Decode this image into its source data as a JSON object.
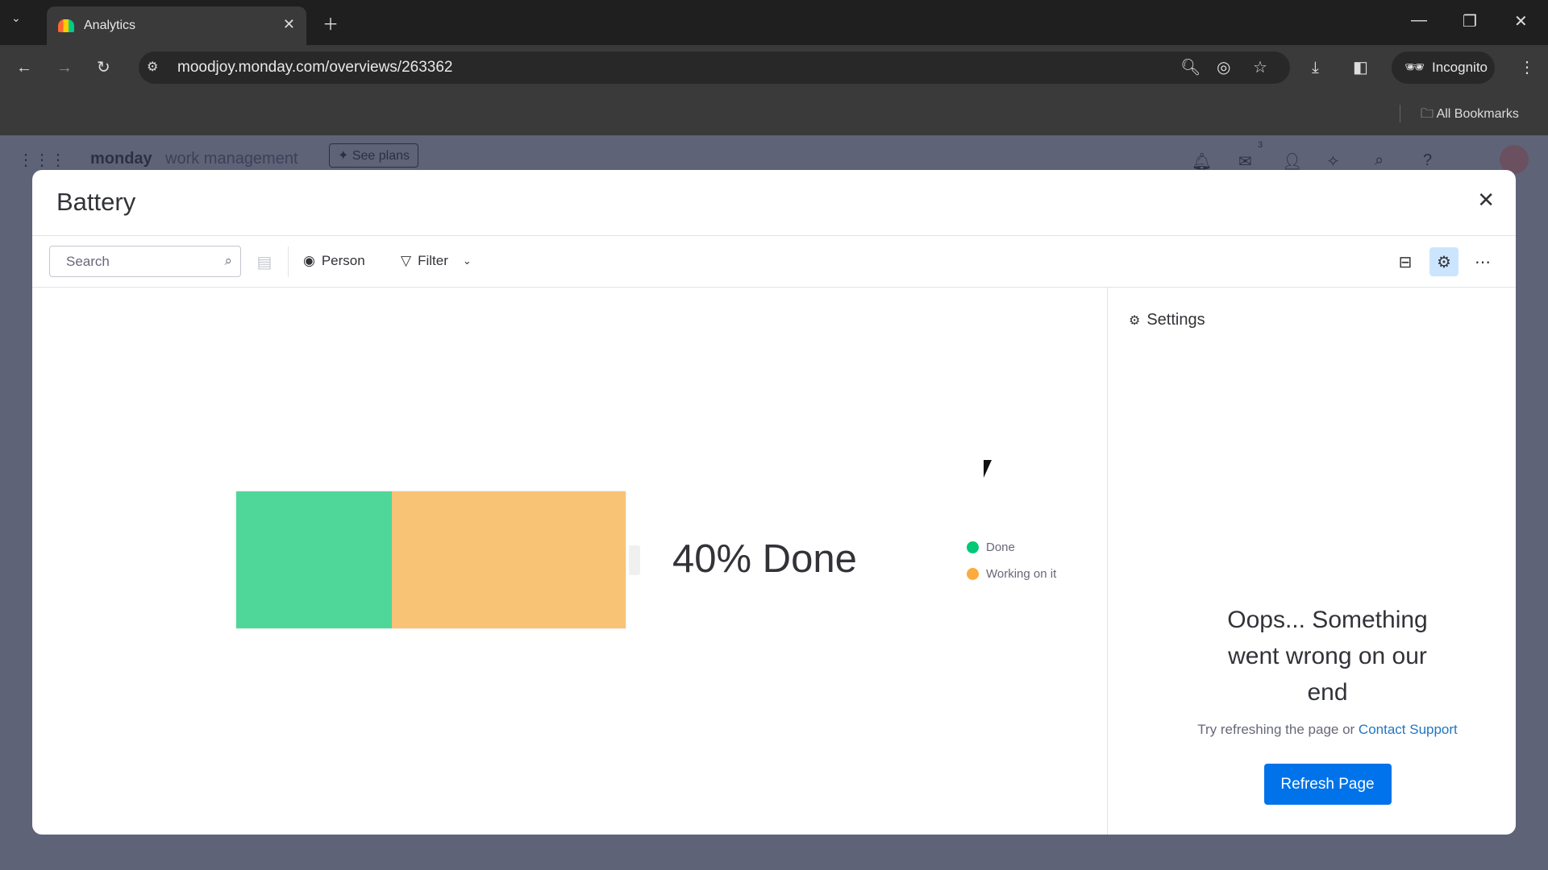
{
  "browser": {
    "tab_title": "Analytics",
    "url": "moodjoy.monday.com/overviews/263362",
    "incognito_label": "Incognito",
    "bookmarks_label": "All Bookmarks"
  },
  "app": {
    "brand": "monday",
    "brand_suffix": "work management",
    "see_plans": "See plans",
    "inbox_count": "3"
  },
  "modal": {
    "title": "Battery",
    "search_placeholder": "Search",
    "person_label": "Person",
    "filter_label": "Filter",
    "settings_label": "Settings"
  },
  "chart_data": {
    "type": "bar",
    "stacked": true,
    "orientation": "horizontal",
    "categories": [
      "Done",
      "Working on it"
    ],
    "values": [
      40,
      60
    ],
    "unit": "%",
    "colors": {
      "Done": "#4fd79a",
      "Working on it": "#f8c374"
    },
    "legend_colors": {
      "Done": "#00c875",
      "Working on it": "#fdab3d"
    },
    "summary_label": "40% Done",
    "legend_placement": "right"
  },
  "error": {
    "title": "Oops... Something went wrong on our end",
    "hint": "Try refreshing the page or ",
    "link": "Contact Support",
    "button": "Refresh Page"
  },
  "colors": {
    "primary": "#0073ea",
    "link": "#1f76c2"
  }
}
